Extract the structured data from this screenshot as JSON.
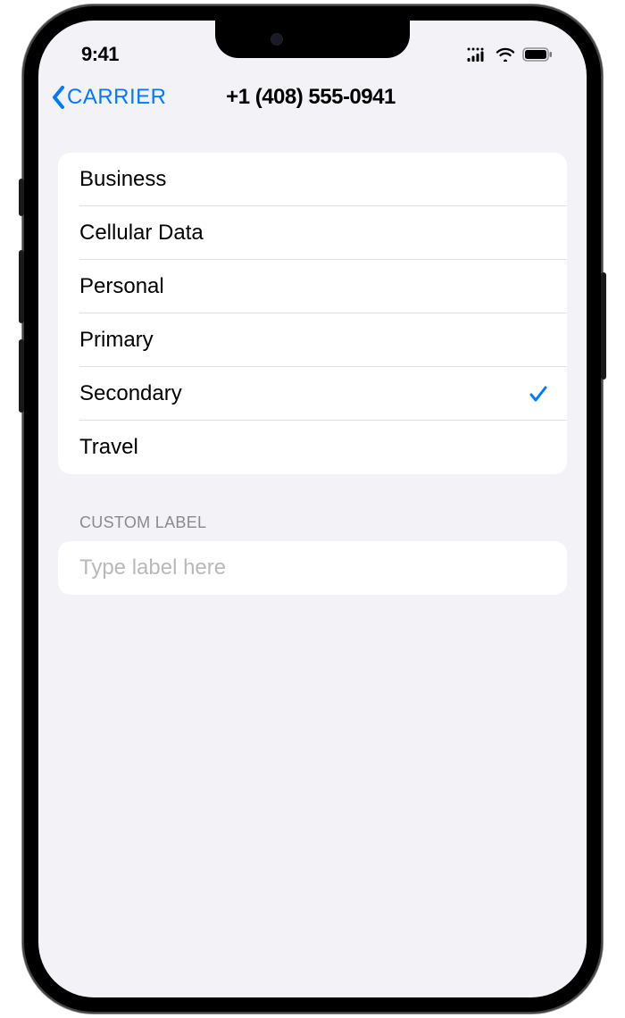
{
  "status": {
    "time": "9:41"
  },
  "nav": {
    "back_label": "CARRIER",
    "title": "+1 (408) 555-0941"
  },
  "labels": [
    {
      "text": "Business",
      "selected": false
    },
    {
      "text": "Cellular Data",
      "selected": false
    },
    {
      "text": "Personal",
      "selected": false
    },
    {
      "text": "Primary",
      "selected": false
    },
    {
      "text": "Secondary",
      "selected": true
    },
    {
      "text": "Travel",
      "selected": false
    }
  ],
  "custom": {
    "header": "CUSTOM LABEL",
    "placeholder": "Type label here",
    "value": ""
  }
}
